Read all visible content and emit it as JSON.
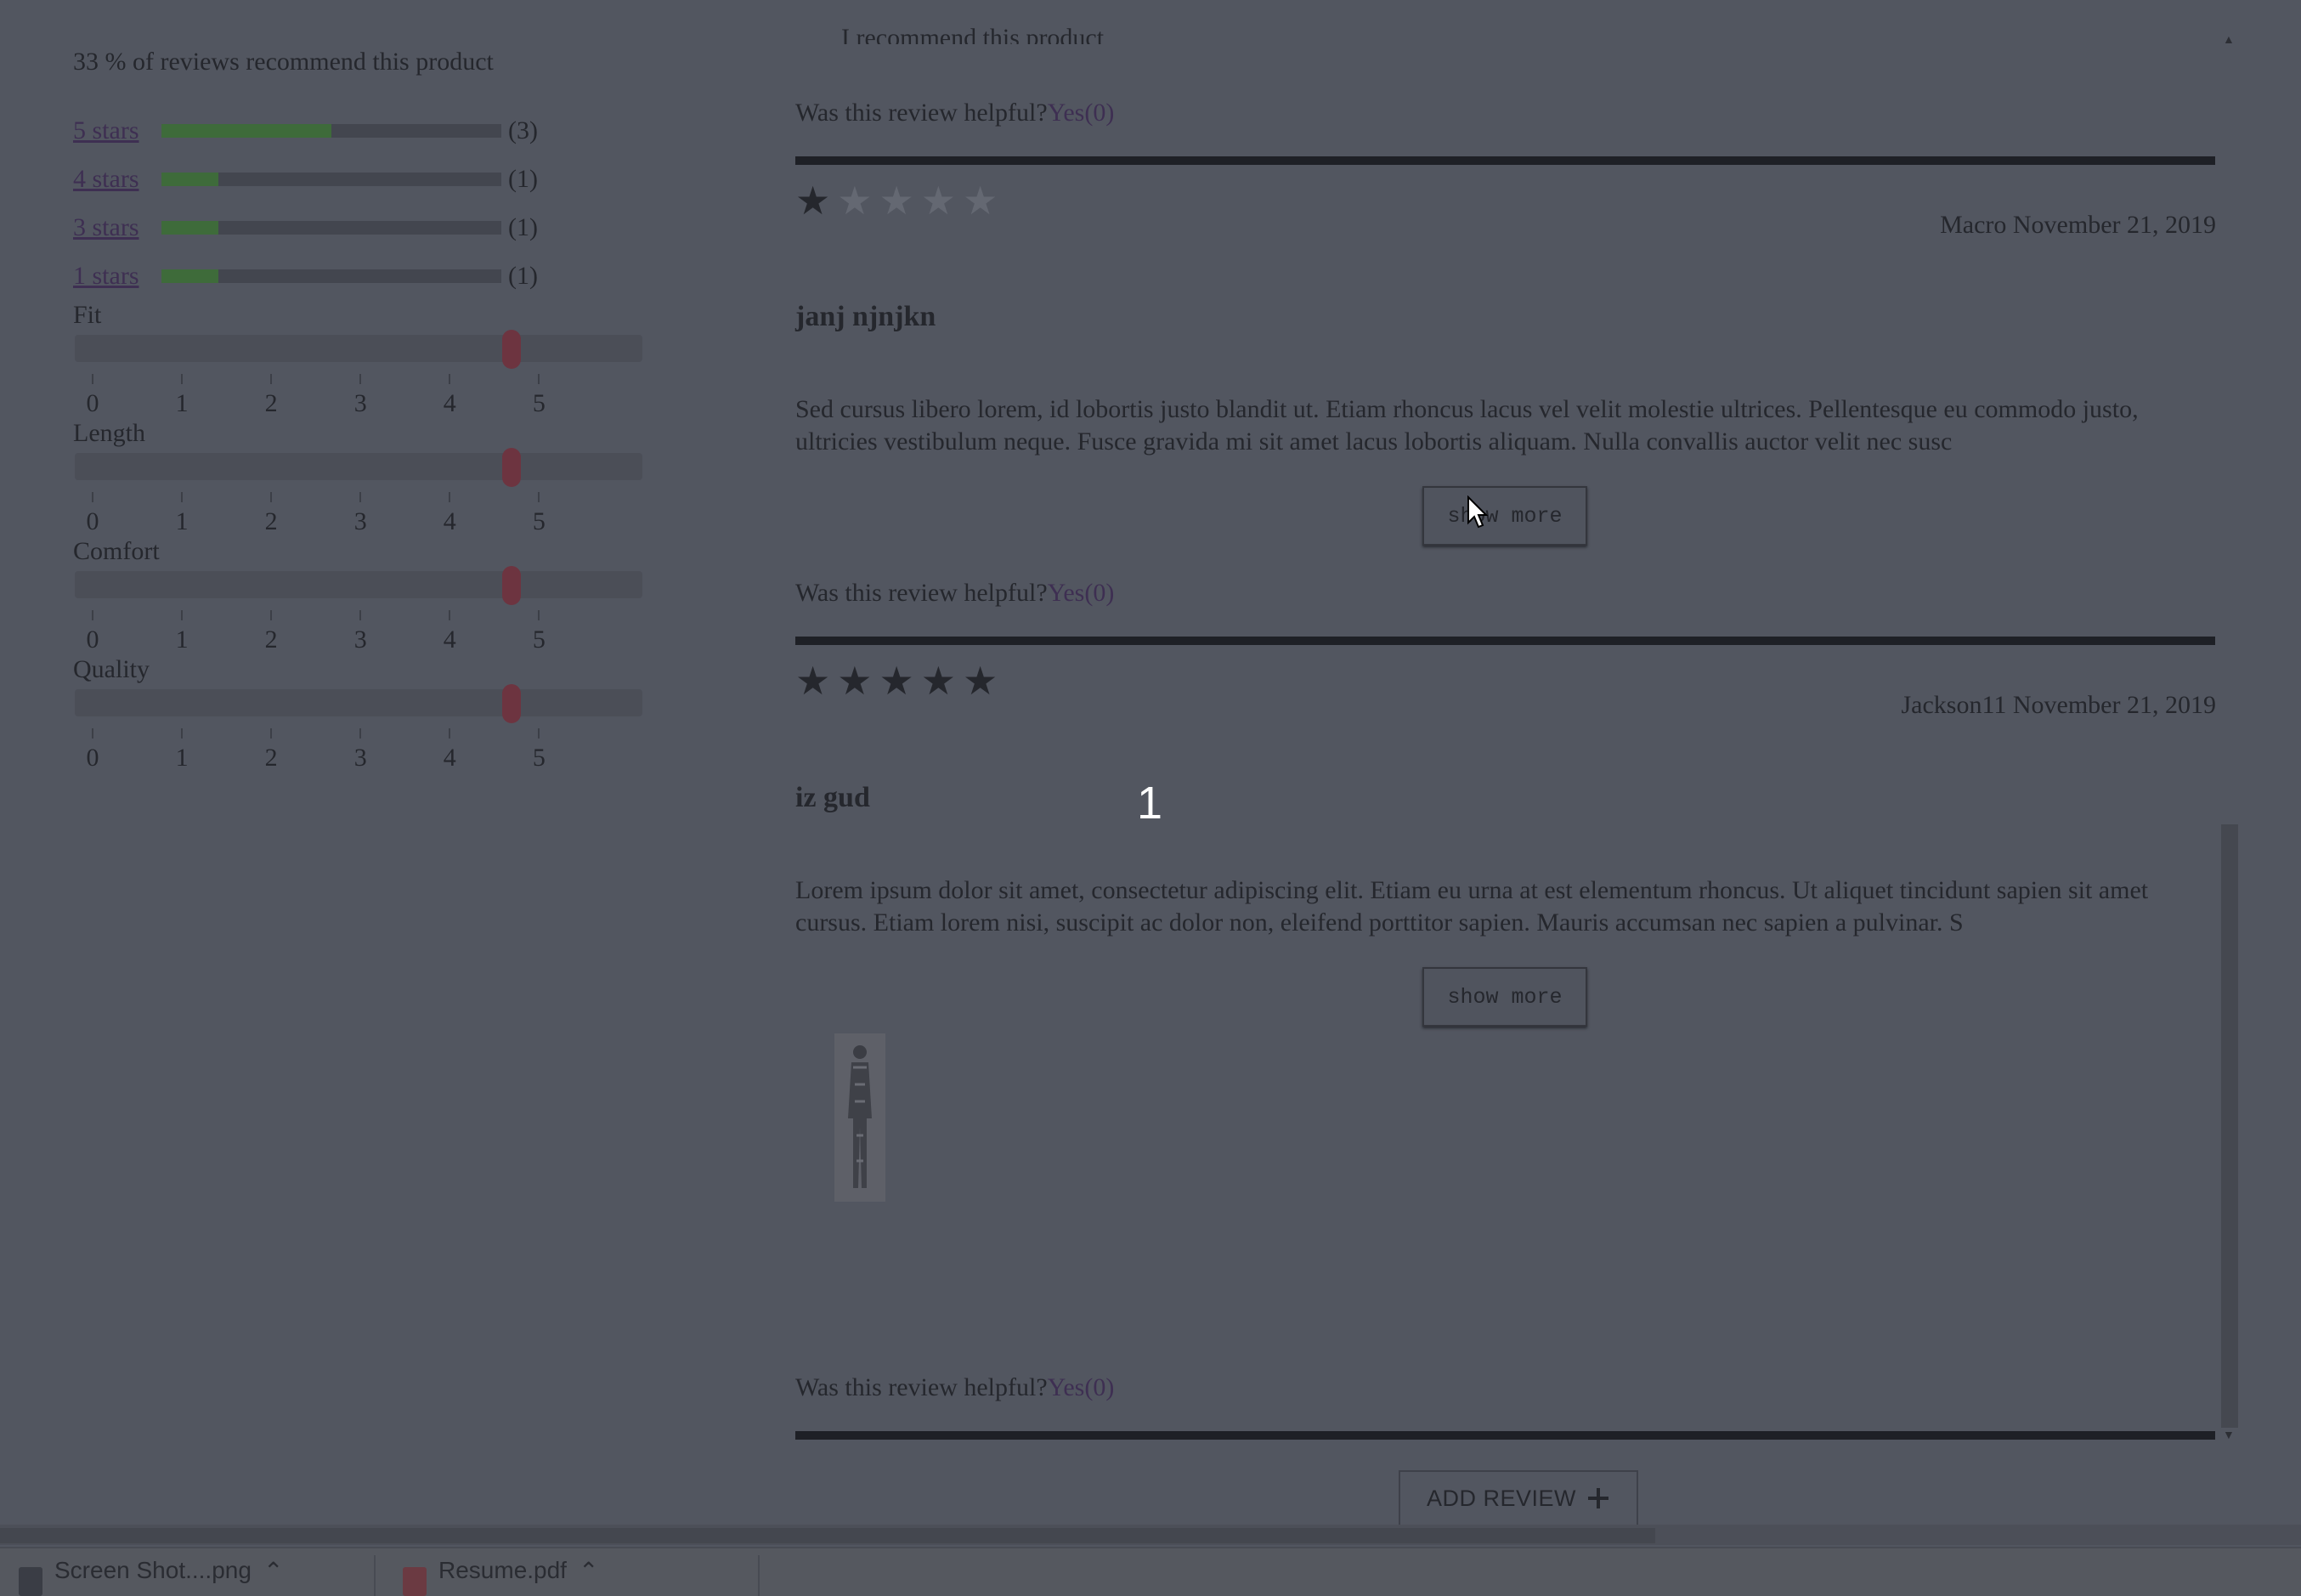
{
  "summary": {
    "recommend_text": "33 % of reviews recommend this product",
    "ratings": [
      {
        "label": "5 stars",
        "count": "(3)",
        "fill_fraction": 0.5
      },
      {
        "label": "4 stars",
        "count": "(1)",
        "fill_fraction": 0.167
      },
      {
        "label": "3 stars",
        "count": "(1)",
        "fill_fraction": 0.167
      },
      {
        "label": "1 stars",
        "count": "(1)",
        "fill_fraction": 0.167
      }
    ],
    "characteristics": [
      {
        "label": "Fit",
        "value": 3.85
      },
      {
        "label": "Length",
        "value": 3.85
      },
      {
        "label": "Comfort",
        "value": 3.85
      },
      {
        "label": "Quality",
        "value": 3.85
      }
    ],
    "scale_labels": [
      "0",
      "1",
      "2",
      "3",
      "4",
      "5"
    ]
  },
  "reviews": {
    "partial_recommend": "I recommend this product",
    "helpful_prompt": "Was this review helpful?",
    "helpful_yes": "Yes(0)",
    "items": [
      {
        "stars": 1,
        "meta": "Macro November 21, 2019",
        "title": "janj njnjkn",
        "body": "Sed cursus libero lorem, id lobortis justo blandit ut. Etiam rhoncus lacus vel velit molestie ultrices. Pellentesque eu commodo justo, ultricies vestibulum neque. Fusce gravida mi sit amet lacus lobortis aliquam. Nulla convallis auctor velit nec susc",
        "show_more": "show more"
      },
      {
        "stars": 5,
        "meta": "Jackson11 November 21, 2019",
        "title": "iz gud",
        "body": "Lorem ipsum dolor sit amet, consectetur adipiscing elit. Etiam eu urna at est elementum rhoncus. Ut aliquet tincidunt sapien sit amet cursus. Etiam lorem nisi, suscipit ac dolor non, eleifend porttitor sapien. Mauris accumsan nec sapien a pulvinar. S",
        "show_more": "show more"
      }
    ],
    "page_number": "1",
    "add_review_label": "ADD REVIEW",
    "add_review_icon": "plus-icon"
  },
  "downloads": {
    "items": [
      {
        "name": "Screen Shot....png",
        "icon": "image-file-icon"
      },
      {
        "name": "Resume.pdf",
        "icon": "pdf-file-icon"
      }
    ]
  },
  "colors": {
    "overlay_bg": "#525660",
    "bar_fill": "#3e6b3a",
    "slider_thumb": "#6d3440",
    "link": "#3e2f52"
  }
}
